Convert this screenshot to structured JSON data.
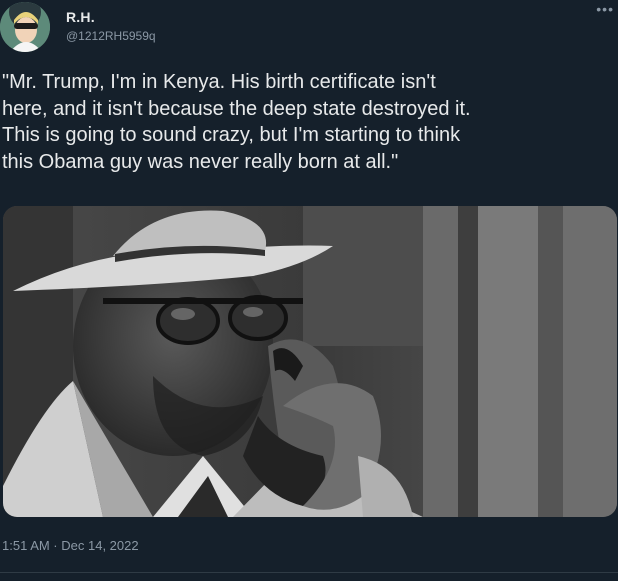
{
  "author": {
    "display_name": "R.H.",
    "handle": "@1212RH5959q"
  },
  "tweet": {
    "text": "\"Mr. Trump, I'm in Kenya. His birth certificate isn't\nhere, and it isn't because the deep state destroyed it.\nThis is going to sound crazy, but I'm starting to think\nthis Obama guy was never really born at all.\"",
    "timestamp": "1:51 AM · Dec 14, 2022"
  },
  "icons": {
    "more": "more-options-icon"
  },
  "colors": {
    "background": "#15202b",
    "text_primary": "#e7e9ea",
    "text_secondary": "#8b98a5"
  }
}
